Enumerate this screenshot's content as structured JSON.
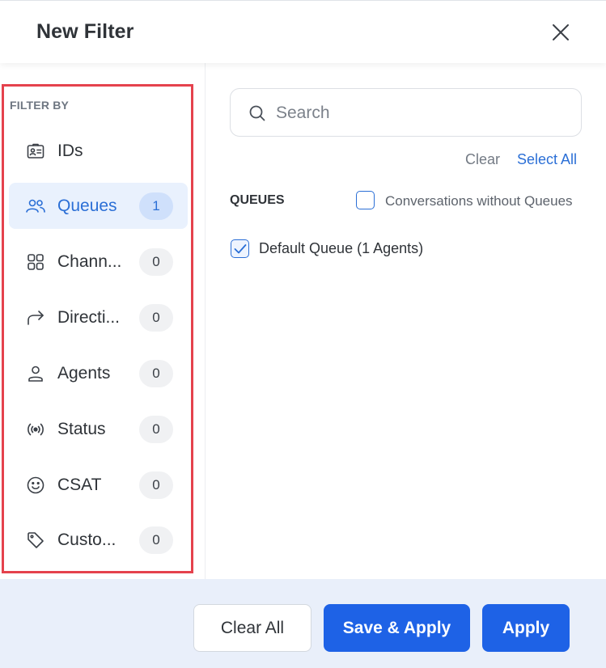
{
  "header": {
    "title": "New Filter",
    "close_icon": "close-icon"
  },
  "sidebar": {
    "heading": "FILTER BY",
    "items": [
      {
        "label": "IDs",
        "icon": "id-card-icon",
        "badge": null,
        "active": false
      },
      {
        "label": "Queues",
        "icon": "users-icon",
        "badge": "1",
        "active": true
      },
      {
        "label": "Chann...",
        "icon": "grid-icon",
        "badge": "0",
        "active": false
      },
      {
        "label": "Directi...",
        "icon": "arrow-redirect-icon",
        "badge": "0",
        "active": false
      },
      {
        "label": "Agents",
        "icon": "user-icon",
        "badge": "0",
        "active": false
      },
      {
        "label": "Status",
        "icon": "broadcast-icon",
        "badge": "0",
        "active": false
      },
      {
        "label": "CSAT",
        "icon": "smiley-icon",
        "badge": "0",
        "active": false
      },
      {
        "label": "Custo...",
        "icon": "tag-icon",
        "badge": "0",
        "active": false
      }
    ]
  },
  "main": {
    "search": {
      "placeholder": "Search",
      "value": ""
    },
    "clear_label": "Clear",
    "select_all_label": "Select All",
    "section_title": "QUEUES",
    "options": [
      {
        "label": "Conversations without Queues",
        "checked": false
      },
      {
        "label": "Default Queue (1 Agents)",
        "checked": true
      }
    ]
  },
  "footer": {
    "clear_all_label": "Clear All",
    "save_apply_label": "Save & Apply",
    "apply_label": "Apply"
  },
  "colors": {
    "accent": "#1e62e6",
    "active_text": "#2b6fd6",
    "active_bg": "#e9f1fd",
    "highlight_border": "#e5424d",
    "footer_bg": "#e9effa"
  }
}
